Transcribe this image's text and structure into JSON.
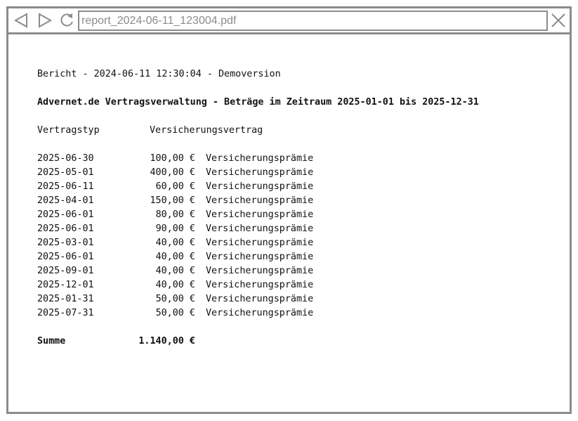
{
  "window": {
    "address": "report_2024-06-11_123004.pdf"
  },
  "icons": {
    "back": "back-arrow-icon",
    "forward": "forward-arrow-icon",
    "reload": "reload-icon",
    "close": "close-icon"
  },
  "colors": {
    "frame": "#8c8c8c",
    "text": "#111111"
  },
  "report": {
    "header": "Bericht - 2024-06-11 12:30:04 - Demoversion",
    "title": "Advernet.de Vertragsverwaltung - Beträge im Zeitraum 2025-01-01 bis 2025-12-31",
    "type_label": "Vertragstyp",
    "type_value": "Versicherungsvertrag",
    "rows": [
      {
        "date": "2025-06-30",
        "amount": "100,00 €",
        "desc": "Versicherungsprämie"
      },
      {
        "date": "2025-05-01",
        "amount": "400,00 €",
        "desc": "Versicherungsprämie"
      },
      {
        "date": "2025-06-11",
        "amount": "60,00 €",
        "desc": "Versicherungsprämie"
      },
      {
        "date": "2025-04-01",
        "amount": "150,00 €",
        "desc": "Versicherungsprämie"
      },
      {
        "date": "2025-06-01",
        "amount": "80,00 €",
        "desc": "Versicherungsprämie"
      },
      {
        "date": "2025-06-01",
        "amount": "90,00 €",
        "desc": "Versicherungsprämie"
      },
      {
        "date": "2025-03-01",
        "amount": "40,00 €",
        "desc": "Versicherungsprämie"
      },
      {
        "date": "2025-06-01",
        "amount": "40,00 €",
        "desc": "Versicherungsprämie"
      },
      {
        "date": "2025-09-01",
        "amount": "40,00 €",
        "desc": "Versicherungsprämie"
      },
      {
        "date": "2025-12-01",
        "amount": "40,00 €",
        "desc": "Versicherungsprämie"
      },
      {
        "date": "2025-01-31",
        "amount": "50,00 €",
        "desc": "Versicherungsprämie"
      },
      {
        "date": "2025-07-31",
        "amount": "50,00 €",
        "desc": "Versicherungsprämie"
      }
    ],
    "total_label": "Summe",
    "total_value": "1.140,00 €"
  }
}
